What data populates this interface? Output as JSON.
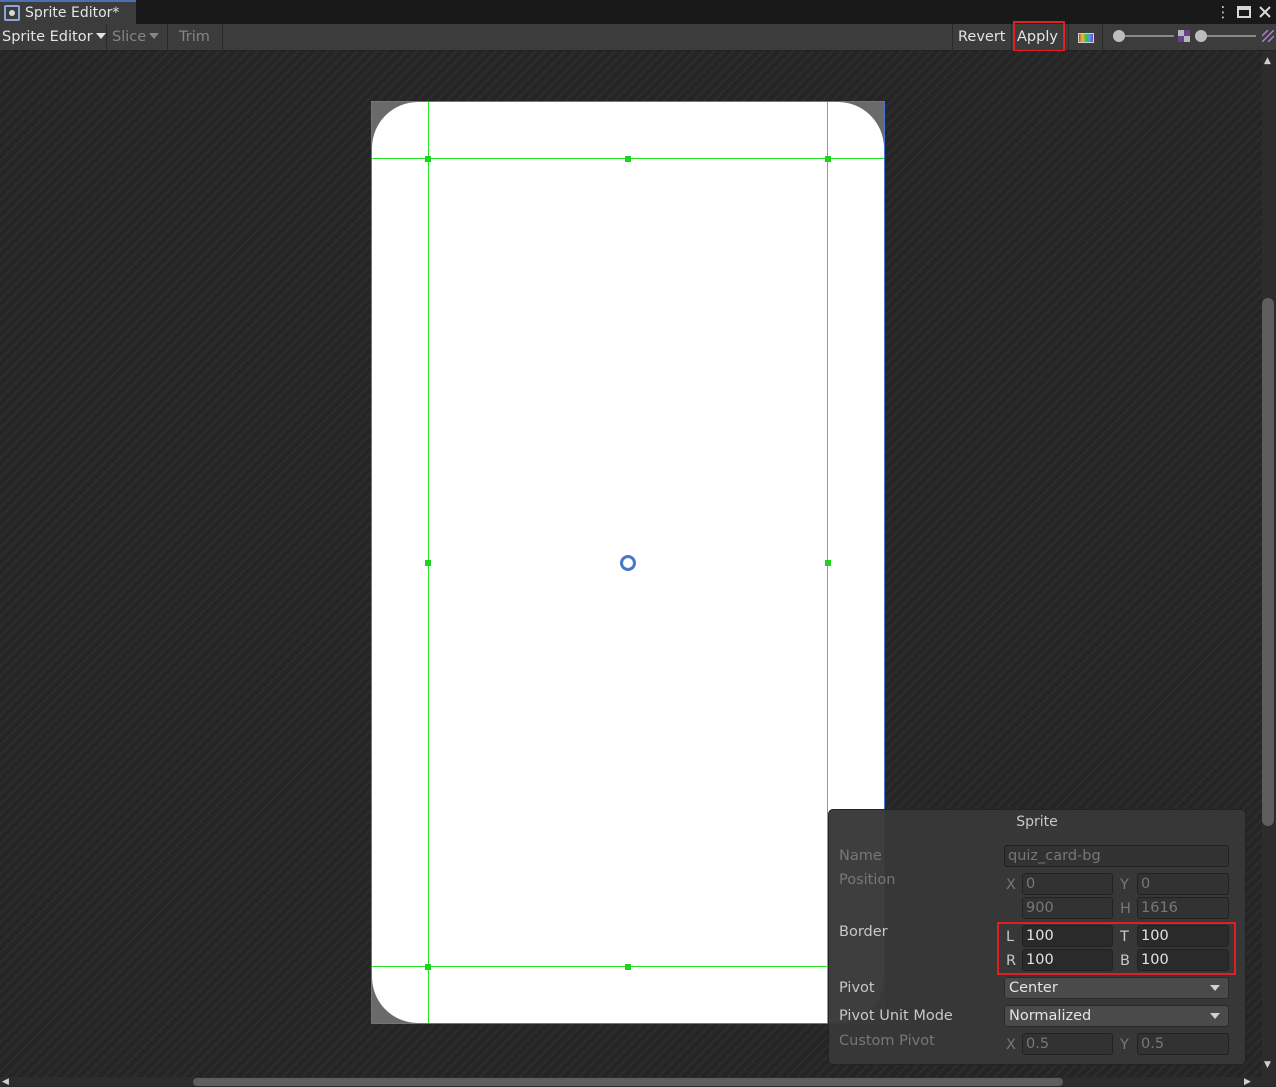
{
  "window": {
    "tab_title": "Sprite Editor*"
  },
  "toolbar": {
    "mode_label": "Sprite Editor",
    "slice_label": "Slice",
    "trim_label": "Trim",
    "revert_label": "Revert",
    "apply_label": "Apply"
  },
  "sprite_panel": {
    "title": "Sprite",
    "name_label": "Name",
    "name_value": "quiz_card-bg",
    "position_label": "Position",
    "pos_x_label": "X",
    "pos_x_value": "0",
    "pos_y_label": "Y",
    "pos_y_value": "0",
    "pos_w_value": "900",
    "pos_h_label": "H",
    "pos_h_value": "1616",
    "border_label": "Border",
    "border_l_label": "L",
    "border_l_value": "100",
    "border_t_label": "T",
    "border_t_value": "100",
    "border_r_label": "R",
    "border_r_value": "100",
    "border_b_label": "B",
    "border_b_value": "100",
    "pivot_label": "Pivot",
    "pivot_value": "Center",
    "pivot_unit_mode_label": "Pivot Unit Mode",
    "pivot_unit_mode_value": "Normalized",
    "custom_pivot_label": "Custom Pivot",
    "custom_x_label": "X",
    "custom_x_value": "0.5",
    "custom_y_label": "Y",
    "custom_y_value": "0.5"
  },
  "icons": {
    "tab": "sprite-editor-icon",
    "more": "kebab-menu-icon",
    "maximize": "maximize-icon",
    "close": "close-icon",
    "channels": "rgb-channel-icon",
    "alpha": "alpha-icon",
    "mip": "mip-level-icon"
  }
}
